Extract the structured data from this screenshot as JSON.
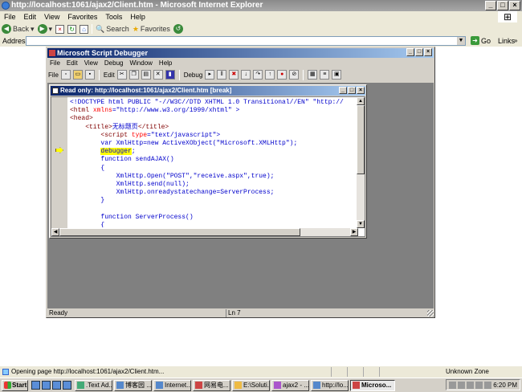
{
  "ie": {
    "title": "http://localhost:1061/ajax2/Client.htm - Microsoft Internet Explorer",
    "menu": [
      "File",
      "Edit",
      "View",
      "Favorites",
      "Tools",
      "Help"
    ],
    "toolbar": {
      "back": "Back",
      "search": "Search",
      "favorites": "Favorites"
    },
    "address_label": "Address",
    "address_value": "",
    "go": "Go",
    "links": "Links",
    "status": "Opening page http://localhost:1061/ajax2/Client.htm...",
    "zone": "Unknown Zone"
  },
  "debugger": {
    "title": "Microsoft Script Debugger",
    "menu": [
      "File",
      "Edit",
      "View",
      "Debug",
      "Window",
      "Help"
    ],
    "toolbar": {
      "file": "File",
      "edit": "Edit",
      "debug": "Debug"
    },
    "child_title": "Read only: http://localhost:1061/ajax2/Client.htm [break]",
    "status_left": "Ready",
    "status_right": "Ln 7"
  },
  "code": {
    "line1": "<!DOCTYPE html PUBLIC \"-//W3C//DTD XHTML 1.0 Transitional//EN\" \"http://",
    "line2a": "<html ",
    "line2b": "xmlns",
    "line2c": "=\"http://www.w3.org/1999/xhtml\" >",
    "line3": "<head>",
    "line4a": "<title>",
    "line4b": "无标题页",
    "line4c": "</title>",
    "line5a": "<script ",
    "line5b": "type",
    "line5c": "=\"text/javascript\">",
    "line6": "var XmlHttp=new ActiveXObject(\"Microsoft.XMLHttp\");",
    "line7a": "debugger",
    "line7b": ";",
    "line8": "function sendAJAX()",
    "line9": "{",
    "line10": "XmlHttp.Open(\"POST\",\"receive.aspx\",true);",
    "line11": "XmlHttp.send(null);",
    "line12": "XmlHttp.onreadystatechange=ServerProcess;",
    "line13": "}",
    "line14": "",
    "line15": "function ServerProcess()",
    "line16": "{"
  },
  "taskbar": {
    "start": "Start",
    "tasks": [
      ".Text Ad...",
      "博客园 ...",
      "Internet...",
      "网易电...",
      "E:\\Soluti...",
      "ajax2 - ...",
      "http://lo...",
      "Microso..."
    ],
    "time": "6:20 PM"
  }
}
